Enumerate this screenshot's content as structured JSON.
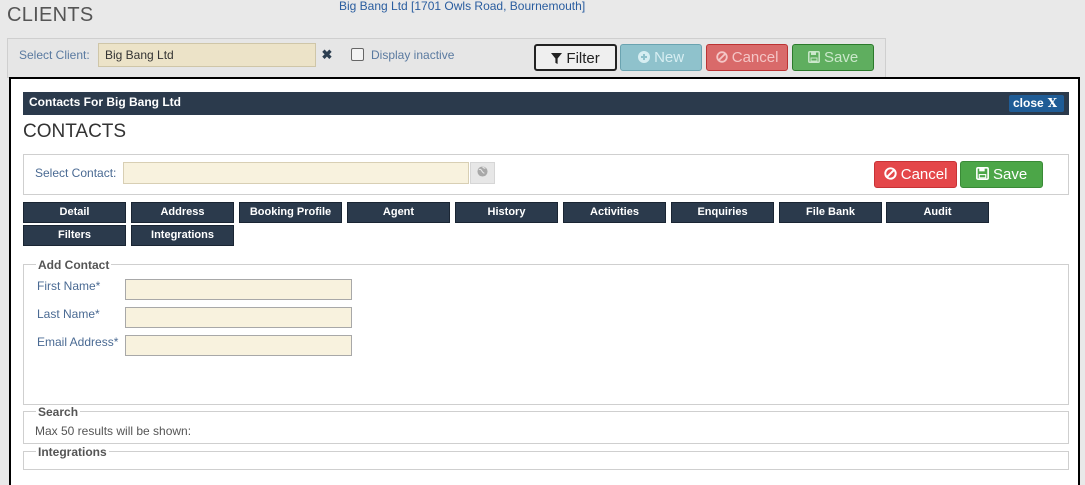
{
  "background": {
    "page_title": "CLIENTS",
    "client_address": "Big Bang Ltd [1701 Owls Road, Bournemouth]",
    "select_client_label": "Select Client:",
    "select_client_value": "Big Bang Ltd",
    "clear_glyph": "✖",
    "display_inactive_label": "Display inactive",
    "buttons": {
      "filter": "Filter",
      "new": "New",
      "cancel": "Cancel",
      "save": "Save"
    }
  },
  "modal": {
    "title": "Contacts For Big Bang Ltd",
    "close_label": "close",
    "close_glyph": "X",
    "heading": "CONTACTS",
    "select_contact_label": "Select Contact:",
    "select_contact_value": "",
    "buttons": {
      "cancel": "Cancel",
      "save": "Save"
    },
    "tabs": [
      "Detail",
      "Address",
      "Booking Profile",
      "Agent",
      "History",
      "Activities",
      "Enquiries",
      "File Bank",
      "Audit",
      "Filters",
      "Integrations"
    ],
    "add_contact": {
      "legend": "Add Contact",
      "first_name_label": "First Name*",
      "last_name_label": "Last Name*",
      "email_label": "Email Address*",
      "first_name_value": "",
      "last_name_value": "",
      "email_value": ""
    },
    "search": {
      "legend": "Search",
      "note": "Max 50 results will be shown:"
    },
    "integrations": {
      "legend": "Integrations"
    }
  },
  "icons": {
    "filter": "filter-icon",
    "new": "plus-circle-icon",
    "cancel": "ban-icon",
    "save": "floppy-disk-icon",
    "globe": "globe-icon",
    "clear": "clear-x-icon",
    "close": "close-icon"
  },
  "colors": {
    "header_navy": "#2b3a4c",
    "close_blue": "#1f5c96",
    "cancel_red": "#e4474a",
    "save_green": "#4ca648",
    "input_cream": "#f8f2de",
    "label_blue": "#4a6a93"
  }
}
